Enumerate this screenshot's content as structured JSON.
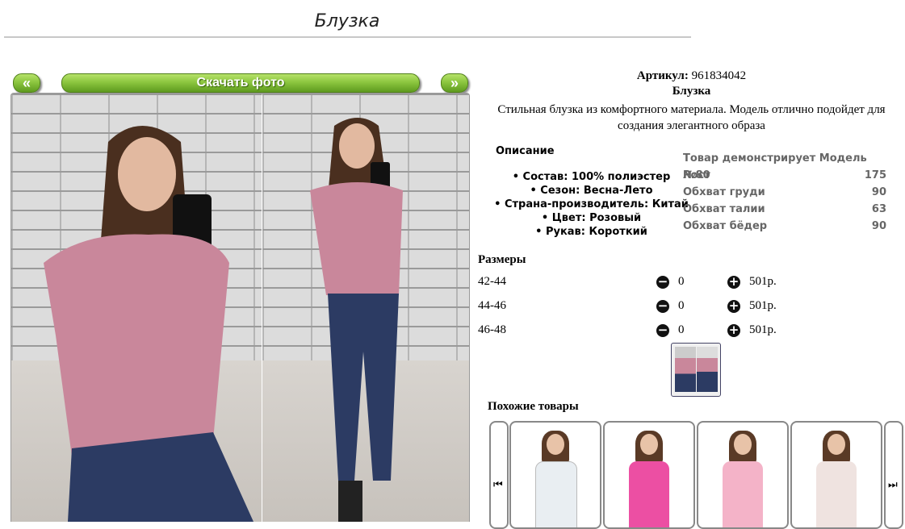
{
  "page": {
    "title": "Блузка"
  },
  "gallery": {
    "prev_label": "«",
    "next_label": "»",
    "download_label": "Скачать фото"
  },
  "product": {
    "article_label": "Артикул:",
    "article": "961834042",
    "name": "Блузка",
    "description": "Стильная блузка из комфортного материала. Модель отлично подойдет для создания элегантного образа"
  },
  "specs": {
    "heading": "Описание",
    "items": [
      "• Состав: 100% полиэстер",
      "• Сезон: Весна-Лето",
      "• Страна-производитель: Китай",
      "• Цвет: Розовый",
      "• Рукав: Короткий"
    ]
  },
  "model": {
    "heading": "Товар демонстрирует Модель №80",
    "rows": [
      {
        "label": "Рост",
        "value": "175"
      },
      {
        "label": "Обхват груди",
        "value": "90"
      },
      {
        "label": "Обхват талии",
        "value": "63"
      },
      {
        "label": "Обхват бёдер",
        "value": "90"
      }
    ]
  },
  "sizes": {
    "heading": "Размеры",
    "rows": [
      {
        "size": "42-44",
        "qty": "0",
        "price": "501р."
      },
      {
        "size": "44-46",
        "qty": "0",
        "price": "501р."
      },
      {
        "size": "46-48",
        "qty": "0",
        "price": "501р."
      }
    ],
    "minus_icon": "minus-circle-icon",
    "plus_icon": "plus-circle-icon"
  },
  "similar": {
    "heading": "Похожие товары",
    "prev_icon": "skip-back-icon",
    "next_icon": "skip-forward-icon",
    "cards": [
      {
        "color": "#e9eef2"
      },
      {
        "color": "#ec4fa3"
      },
      {
        "color": "#f4b3c8"
      },
      {
        "color": "#efe3e0"
      }
    ]
  },
  "colors": {
    "button_green": "#8cc63f",
    "blouse_pink": "#c9879b",
    "jeans_blue": "#2c3b63"
  }
}
